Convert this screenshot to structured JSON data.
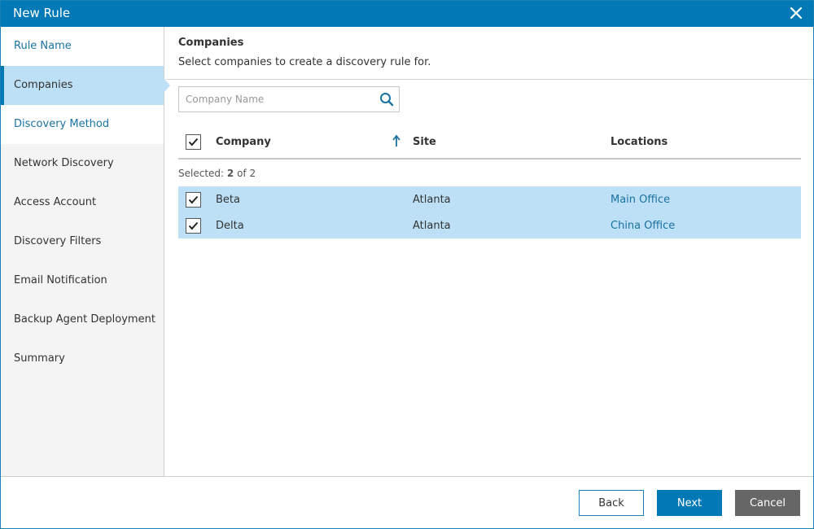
{
  "window": {
    "title": "New Rule"
  },
  "colors": {
    "accent": "#0179b6",
    "selected_row": "#bde0f6",
    "link": "#1a72a0"
  },
  "steps": [
    {
      "label": "Rule Name",
      "state": "done"
    },
    {
      "label": "Companies",
      "state": "active"
    },
    {
      "label": "Discovery Method",
      "state": "done"
    },
    {
      "label": "Network Discovery",
      "state": "pending"
    },
    {
      "label": "Access Account",
      "state": "pending"
    },
    {
      "label": "Discovery Filters",
      "state": "pending"
    },
    {
      "label": "Email Notification",
      "state": "pending"
    },
    {
      "label": "Backup Agent Deployment",
      "state": "pending"
    },
    {
      "label": "Summary",
      "state": "pending"
    }
  ],
  "page": {
    "title": "Companies",
    "subtitle": "Select companies to create a discovery rule for."
  },
  "search": {
    "placeholder": "Company Name",
    "value": "",
    "icon": "search-icon"
  },
  "grid": {
    "columns": {
      "company": "Company",
      "site": "Site",
      "locations": "Locations"
    },
    "sort": {
      "column": "company",
      "direction": "ascending"
    },
    "header_checkbox_checked": true,
    "selection": {
      "prefix": "Selected:",
      "selected": "2",
      "separator": "of",
      "total": "2"
    },
    "rows": [
      {
        "company": "Beta",
        "site": "Atlanta",
        "location": "Main Office",
        "checked": true
      },
      {
        "company": "Delta",
        "site": "Atlanta",
        "location": "China Office",
        "checked": true
      }
    ]
  },
  "footer": {
    "back": "Back",
    "next": "Next",
    "cancel": "Cancel"
  }
}
